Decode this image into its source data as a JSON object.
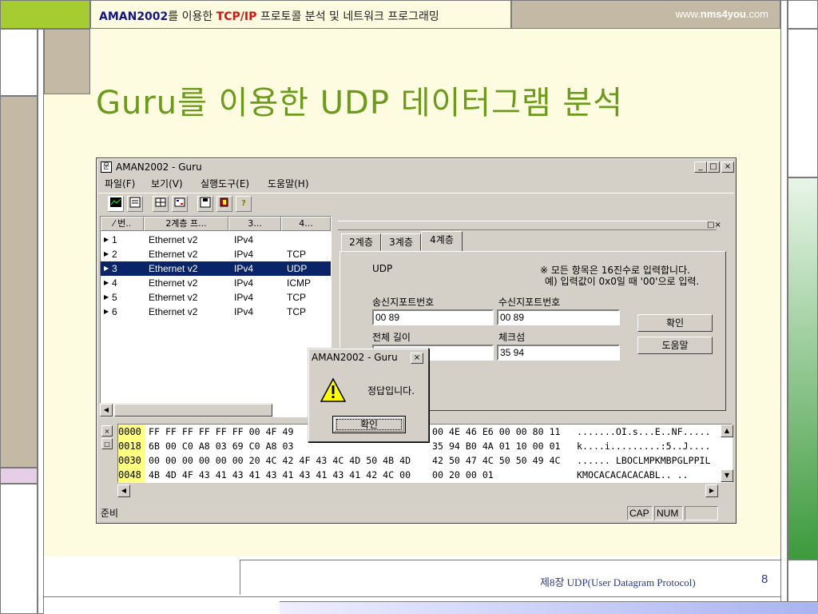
{
  "slide": {
    "header_brand": "AMAN2002",
    "header_mid": "를 이용한 ",
    "header_proto": "TCP/IP",
    "header_rest": " 프로토콜 분석 및 네트워크 프로그래밍",
    "www_prefix": "www.",
    "www_bold": "nms4you",
    "www_suffix": ".com",
    "title": "Guru를 이용한 UDP 데이터그램 분석",
    "footer": "제8장  UDP(User Datagram Protocol)",
    "page_number": "8",
    "colors": {
      "accent_green": "#6b9b1a",
      "brand_blue": "#13138a",
      "proto_red": "#d4140f"
    }
  },
  "window": {
    "title": "AMAN2002 - Guru",
    "app_icon": "guru-app-icon",
    "controls": {
      "minimize": "_",
      "maximize": "□",
      "close": "×"
    },
    "menu": [
      "파일(F)",
      "보기(V)",
      "실행도구(E)",
      "도움말(H)"
    ],
    "toolbar_icons": [
      "graph-icon",
      "capture-icon",
      "protocol-icon",
      "filter-icon",
      "save-icon",
      "book-icon",
      "help-icon"
    ]
  },
  "list": {
    "columns": [
      "번..",
      "2계층 프...",
      "3...",
      "4..."
    ],
    "rows": [
      {
        "num": "1",
        "l2": "Ethernet v2",
        "l3": "IPv4",
        "l4": ""
      },
      {
        "num": "2",
        "l2": "Ethernet v2",
        "l3": "IPv4",
        "l4": "TCP"
      },
      {
        "num": "3",
        "l2": "Ethernet v2",
        "l3": "IPv4",
        "l4": "UDP"
      },
      {
        "num": "4",
        "l2": "Ethernet v2",
        "l3": "IPv4",
        "l4": "ICMP"
      },
      {
        "num": "5",
        "l2": "Ethernet v2",
        "l3": "IPv4",
        "l4": "TCP"
      },
      {
        "num": "6",
        "l2": "Ethernet v2",
        "l3": "IPv4",
        "l4": "TCP"
      }
    ],
    "selected_row": 3
  },
  "panel": {
    "controls": "□×",
    "tabs": [
      "2계층",
      "3계층",
      "4계층"
    ],
    "active_tab": "4계층",
    "protocol": "UDP",
    "note_line1": "※ 모든 항목은 16진수로 입력합니다.",
    "note_line2": "예) 입력값이 0x0일 때 '00'으로 입력.",
    "src_port_label": "송신지포트번호",
    "src_port_value": "00 89",
    "dst_port_label": "수신지포트번호",
    "dst_port_value": "00 89",
    "length_label": "전체 길이",
    "length_value": "",
    "checksum_label": "체크섬",
    "checksum_value": "35 94",
    "ok_button": "확인",
    "help_button": "도움말"
  },
  "hex": {
    "rows": [
      {
        "offset": "0000",
        "bytes": "FF FF FF FF FF FF 00 4F 49",
        "bytes2": "00 4E 46 E6 00 00 80 11",
        "ascii": ".......OI.s...E..NF....."
      },
      {
        "offset": "0018",
        "bytes": "6B 00 C0 A8 03 69 C0 A8 03",
        "bytes2": "35 94 B0 4A 01 10 00 01",
        "ascii": "k....i.........:5..J...."
      },
      {
        "offset": "0030",
        "bytes": "00 00 00 00 00 00 20 4C 42 4F 43 4C 4D 50 4B 4D",
        "bytes2": "42 50 47 4C 50 50 49 4C",
        "ascii": "...... LBOCLMPKMBPGLPPIL"
      },
      {
        "offset": "0048",
        "bytes": "4B 4D 4F 43 41 43 41 43 41 43 41 43 41 42 4C 00",
        "bytes2": "00 20 00 01",
        "ascii": "KMOCACACACACABL.. .."
      }
    ]
  },
  "status": {
    "text": "준비",
    "cap": "CAP",
    "num": "NUM"
  },
  "dialog": {
    "title": "AMAN2002 - Guru",
    "close": "×",
    "message": "정답입니다.",
    "ok": "확인",
    "icon": "warning-icon"
  }
}
